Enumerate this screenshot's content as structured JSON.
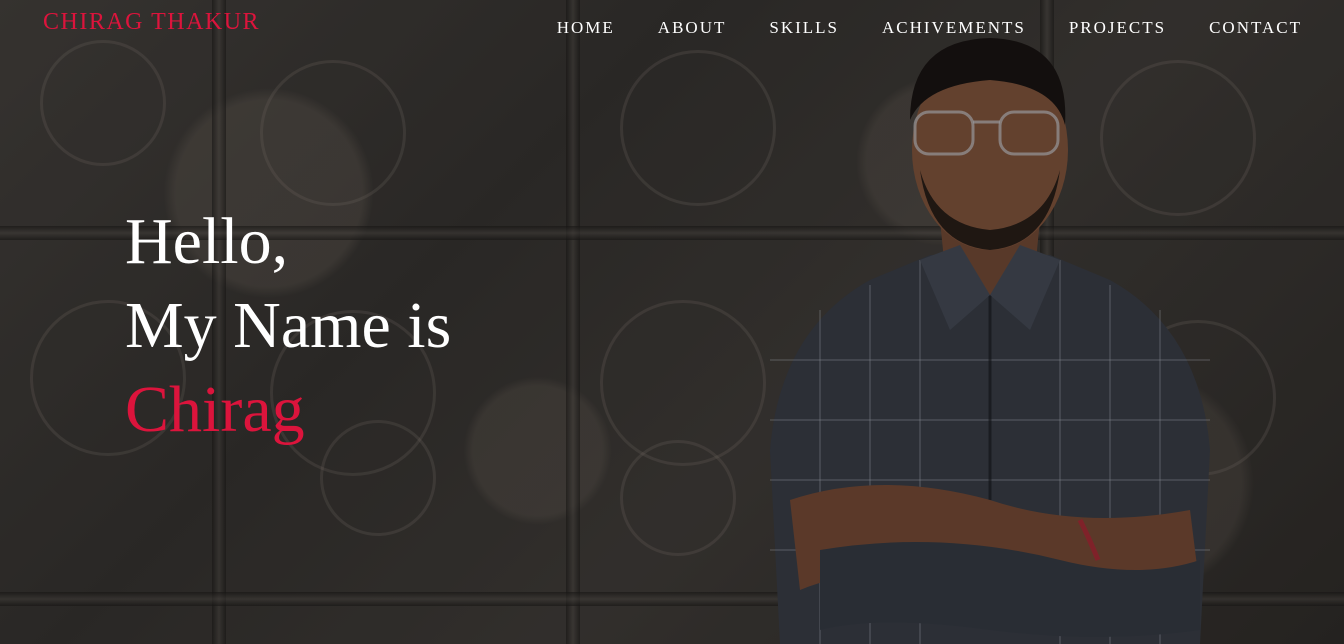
{
  "brand": {
    "logo_text": "CHIRAG THAKUR"
  },
  "nav": {
    "items": [
      {
        "label": "HOME"
      },
      {
        "label": "ABOUT"
      },
      {
        "label": "SKILLS"
      },
      {
        "label": "ACHIVEMENTS"
      },
      {
        "label": "PROJECTS"
      },
      {
        "label": "CONTACT"
      }
    ]
  },
  "hero": {
    "line1": "Hello,",
    "line2": "My Name is",
    "name": "Chirag"
  },
  "colors": {
    "accent": "#dc143c",
    "text": "#ffffff",
    "background": "#3a3734"
  }
}
